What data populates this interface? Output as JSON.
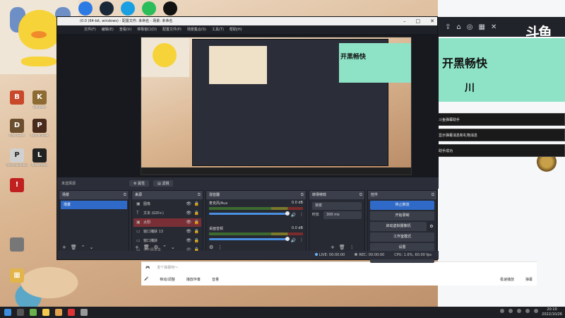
{
  "desktop": {
    "icons": [
      {
        "label": "",
        "color": "#c9482a",
        "glyph": "B"
      },
      {
        "label": "Kingdom",
        "color": "#8d6b32",
        "glyph": "K"
      },
      {
        "label": "Dark Souls",
        "color": "#6b4e2e",
        "glyph": "D"
      },
      {
        "label": "Path of Exile",
        "color": "#4a2a1a",
        "glyph": "P"
      },
      {
        "label": "Phasmophobia",
        "color": "#d0d0d0",
        "glyph": "P"
      },
      {
        "label": "Pushcrafter",
        "color": "#222222",
        "glyph": "L"
      },
      {
        "label": "",
        "color": "#c02020",
        "glyph": "!"
      },
      {
        "label": "",
        "color": "#e1b54a",
        "glyph": "▦"
      }
    ]
  },
  "obs": {
    "title": "(0.0 (64-bit, windows) - 配置文件: 未命名 - 场景: 未命名",
    "menu": [
      "文件(F)",
      "编辑(E)",
      "查看(V)",
      "停靠窗口(D)",
      "配置文件(P)",
      "场景集合(S)",
      "工具(T)",
      "帮助(H)"
    ],
    "no_source": "未选择源",
    "props_btn": "属性",
    "filters_btn": "滤镜",
    "scenes": {
      "title": "场景",
      "items": [
        "场景"
      ]
    },
    "sources": {
      "title": "来源",
      "items": [
        {
          "name": "图像",
          "selected": false
        },
        {
          "name": "文本 (GDI+)",
          "selected": false
        },
        {
          "name": "太阳",
          "selected": true
        },
        {
          "name": "窗口捕获 13",
          "selected": false
        },
        {
          "name": "窗口捕获",
          "selected": false
        },
        {
          "name": "显示器采集",
          "selected": false
        }
      ]
    },
    "mixer": {
      "title": "混音器",
      "channels": [
        {
          "name": "麦克风/Aux",
          "db": "0.0 dB"
        },
        {
          "name": "桌面音频",
          "db": "0.0 dB"
        }
      ]
    },
    "transitions": {
      "title": "转场特效",
      "selected": "渐变",
      "duration_label": "时长",
      "duration": "300 ms"
    },
    "controls": {
      "title": "控件",
      "buttons": [
        "停止推流",
        "开始录制",
        "启动虚拟摄像机",
        "工作室模式",
        "设置",
        "退出"
      ]
    },
    "status": {
      "live": "LIVE: 00:00:00",
      "rec": "REC: 00:00:00",
      "cpu": "CPU: 1.6%, 60.00 fps"
    }
  },
  "douyu": {
    "logo": "斗鱼",
    "banner": "开黑畅快",
    "banner_sub": "川",
    "notifications": [
      "欢迎使用斗鱼弹幕助手",
      "本区域会显示弹幕消息和礼物消息",
      "添加弹幕助手成功"
    ],
    "chat_placeholder": "发个弹幕吧～",
    "tools": [
      "移动/调整",
      "播放伴奏",
      "音量"
    ],
    "right_tools": [
      "极速播放",
      "弹幕"
    ]
  },
  "taskbar": {
    "time": "20:10",
    "date": "2022/10/26"
  }
}
